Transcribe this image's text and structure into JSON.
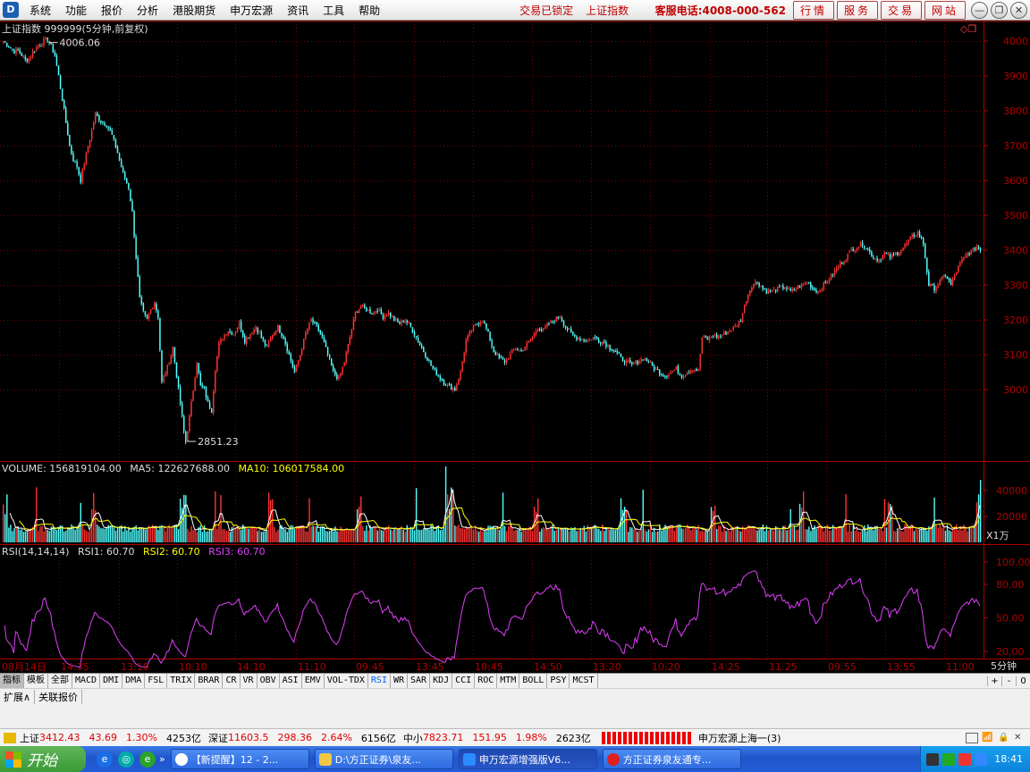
{
  "menubar": {
    "app_icon_text": "D",
    "items": [
      "系统",
      "功能",
      "报价",
      "分析",
      "港股期货",
      "申万宏源",
      "资讯",
      "工具",
      "帮助"
    ],
    "notices": [
      "交易已锁定",
      "上证指数"
    ],
    "hotline": "客服电话:4008-000-562",
    "service_buttons": [
      "行情",
      "服务",
      "交易",
      "网站"
    ]
  },
  "chart": {
    "title": "上证指数 999999(5分钟,前复权)",
    "price_ticks": [
      "4000",
      "3900",
      "3800",
      "3700",
      "3600",
      "3500",
      "3400",
      "3300",
      "3200",
      "3100",
      "3000"
    ],
    "high_label": "4006.06",
    "low_label": "2851.23",
    "volume": {
      "header": [
        "VOLUME: 156819104.00",
        "MA5: 122627688.00",
        "MA10: 106017584.00"
      ],
      "ticks": [
        "40000",
        "20000"
      ],
      "unit": "X1万"
    },
    "rsi": {
      "header": [
        "RSI(14,14,14)",
        "RSI1: 60.70",
        "RSI2: 60.70",
        "RSI3: 60.70"
      ],
      "ticks": [
        "100.00",
        "80.00",
        "50.00",
        "20.00"
      ]
    },
    "time_axis": [
      "08月14日",
      "14:35",
      "13:10",
      "10:10",
      "14:10",
      "11:10",
      "09:45",
      "13:45",
      "10:45",
      "14:50",
      "13:20",
      "10:20",
      "14:25",
      "11:25",
      "09:55",
      "13:55",
      "11:00"
    ],
    "period_label": "5分钟"
  },
  "chart_data": {
    "type": "candlestick",
    "price_ylim": [
      2800,
      4030
    ],
    "high": 4006.06,
    "low": 2851.23,
    "approx_path": [
      [
        0,
        4000
      ],
      [
        3,
        3985
      ],
      [
        6,
        3970
      ],
      [
        8,
        3975
      ],
      [
        10,
        3960
      ],
      [
        12,
        3945
      ],
      [
        14,
        3950
      ],
      [
        16,
        3970
      ],
      [
        18,
        3980
      ],
      [
        20,
        3990
      ],
      [
        22,
        4000
      ],
      [
        24,
        4006
      ],
      [
        26,
        3985
      ],
      [
        28,
        3960
      ],
      [
        30,
        3900
      ],
      [
        33,
        3800
      ],
      [
        36,
        3700
      ],
      [
        38,
        3660
      ],
      [
        40,
        3640
      ],
      [
        42,
        3600
      ],
      [
        44,
        3650
      ],
      [
        47,
        3720
      ],
      [
        50,
        3790
      ],
      [
        53,
        3770
      ],
      [
        56,
        3760
      ],
      [
        59,
        3730
      ],
      [
        62,
        3680
      ],
      [
        65,
        3620
      ],
      [
        68,
        3580
      ],
      [
        70,
        3510
      ],
      [
        72,
        3380
      ],
      [
        74,
        3260
      ],
      [
        76,
        3220
      ],
      [
        78,
        3200
      ],
      [
        80,
        3230
      ],
      [
        82,
        3250
      ],
      [
        84,
        3210
      ],
      [
        86,
        3020
      ],
      [
        88,
        3050
      ],
      [
        90,
        3080
      ],
      [
        92,
        3120
      ],
      [
        94,
        3040
      ],
      [
        96,
        2960
      ],
      [
        98,
        2880
      ],
      [
        99,
        2851
      ],
      [
        101,
        2920
      ],
      [
        103,
        3000
      ],
      [
        105,
        3080
      ],
      [
        107,
        3010
      ],
      [
        109,
        3000
      ],
      [
        111,
        2960
      ],
      [
        113,
        2940
      ],
      [
        115,
        3060
      ],
      [
        117,
        3130
      ],
      [
        119,
        3150
      ],
      [
        122,
        3170
      ],
      [
        125,
        3160
      ],
      [
        128,
        3190
      ],
      [
        131,
        3140
      ],
      [
        134,
        3160
      ],
      [
        137,
        3180
      ],
      [
        140,
        3150
      ],
      [
        143,
        3120
      ],
      [
        146,
        3160
      ],
      [
        149,
        3180
      ],
      [
        152,
        3150
      ],
      [
        155,
        3100
      ],
      [
        158,
        3050
      ],
      [
        161,
        3100
      ],
      [
        164,
        3160
      ],
      [
        167,
        3200
      ],
      [
        170,
        3180
      ],
      [
        173,
        3150
      ],
      [
        176,
        3100
      ],
      [
        179,
        3050
      ],
      [
        182,
        3030
      ],
      [
        185,
        3080
      ],
      [
        188,
        3150
      ],
      [
        191,
        3220
      ],
      [
        194,
        3240
      ],
      [
        197,
        3230
      ],
      [
        200,
        3220
      ],
      [
        203,
        3230
      ],
      [
        206,
        3210
      ],
      [
        209,
        3220
      ],
      [
        212,
        3200
      ],
      [
        215,
        3190
      ],
      [
        218,
        3200
      ],
      [
        221,
        3180
      ],
      [
        224,
        3150
      ],
      [
        227,
        3120
      ],
      [
        230,
        3090
      ],
      [
        233,
        3060
      ],
      [
        236,
        3040
      ],
      [
        239,
        3020
      ],
      [
        242,
        3010
      ],
      [
        245,
        3000
      ],
      [
        248,
        3050
      ],
      [
        251,
        3140
      ],
      [
        254,
        3170
      ],
      [
        257,
        3190
      ],
      [
        260,
        3200
      ],
      [
        263,
        3160
      ],
      [
        266,
        3110
      ],
      [
        269,
        3090
      ],
      [
        272,
        3080
      ],
      [
        275,
        3100
      ],
      [
        278,
        3120
      ],
      [
        281,
        3110
      ],
      [
        284,
        3130
      ],
      [
        287,
        3150
      ],
      [
        290,
        3180
      ],
      [
        293,
        3170
      ],
      [
        296,
        3190
      ],
      [
        299,
        3200
      ],
      [
        302,
        3210
      ],
      [
        305,
        3180
      ],
      [
        308,
        3160
      ],
      [
        311,
        3150
      ],
      [
        314,
        3145
      ],
      [
        317,
        3140
      ],
      [
        320,
        3150
      ],
      [
        323,
        3140
      ],
      [
        326,
        3135
      ],
      [
        329,
        3120
      ],
      [
        332,
        3110
      ],
      [
        335,
        3090
      ],
      [
        338,
        3080
      ],
      [
        341,
        3070
      ],
      [
        344,
        3080
      ],
      [
        347,
        3090
      ],
      [
        350,
        3080
      ],
      [
        353,
        3060
      ],
      [
        356,
        3050
      ],
      [
        359,
        3040
      ],
      [
        362,
        3050
      ],
      [
        365,
        3060
      ],
      [
        368,
        3040
      ],
      [
        371,
        3050
      ],
      [
        374,
        3060
      ],
      [
        377,
        3055
      ],
      [
        379,
        3150
      ],
      [
        382,
        3145
      ],
      [
        385,
        3155
      ],
      [
        388,
        3150
      ],
      [
        391,
        3160
      ],
      [
        394,
        3170
      ],
      [
        397,
        3180
      ],
      [
        400,
        3200
      ],
      [
        403,
        3260
      ],
      [
        406,
        3300
      ],
      [
        409,
        3310
      ],
      [
        412,
        3290
      ],
      [
        415,
        3280
      ],
      [
        418,
        3285
      ],
      [
        421,
        3290
      ],
      [
        424,
        3295
      ],
      [
        427,
        3280
      ],
      [
        430,
        3290
      ],
      [
        433,
        3300
      ],
      [
        436,
        3310
      ],
      [
        439,
        3290
      ],
      [
        442,
        3280
      ],
      [
        445,
        3300
      ],
      [
        448,
        3320
      ],
      [
        451,
        3340
      ],
      [
        454,
        3360
      ],
      [
        457,
        3380
      ],
      [
        460,
        3400
      ],
      [
        463,
        3410
      ],
      [
        466,
        3420
      ],
      [
        469,
        3400
      ],
      [
        472,
        3380
      ],
      [
        475,
        3370
      ],
      [
        478,
        3390
      ],
      [
        481,
        3380
      ],
      [
        484,
        3390
      ],
      [
        487,
        3400
      ],
      [
        490,
        3420
      ],
      [
        493,
        3440
      ],
      [
        496,
        3450
      ],
      [
        499,
        3420
      ],
      [
        502,
        3300
      ],
      [
        505,
        3290
      ],
      [
        508,
        3310
      ],
      [
        511,
        3330
      ],
      [
        514,
        3300
      ],
      [
        517,
        3340
      ],
      [
        520,
        3370
      ],
      [
        523,
        3390
      ],
      [
        526,
        3400
      ],
      [
        528,
        3410
      ],
      [
        530,
        3400
      ]
    ],
    "volume_ylim": [
      0,
      50000
    ],
    "volume_unit": "X1万",
    "volume_ma": {
      "VOLUME": 156819104.0,
      "MA5": 122627688.0,
      "MA10": 106017584.0
    },
    "rsi_ylim": [
      10,
      105
    ],
    "rsi_latest": {
      "RSI1": 60.7,
      "RSI2": 60.7,
      "RSI3": 60.7
    },
    "colors": {
      "up": "#ff3333",
      "down": "#54ffff",
      "axis": "#b00000",
      "grid": "#7a0000",
      "rsi": "#e040fb",
      "ma10": "#ffff00",
      "ma5": "#ffffff"
    }
  },
  "toolbar": {
    "tools": [
      "指标",
      "模板",
      "全部",
      "MACD",
      "DMI",
      "DMA",
      "FSL",
      "TRIX",
      "BRAR",
      "CR",
      "VR",
      "OBV",
      "ASI",
      "EMV",
      "VOL-TDX",
      "RSI",
      "WR",
      "SAR",
      "KDJ",
      "CCI",
      "ROC",
      "MTM",
      "BOLL",
      "PSY",
      "MCST"
    ],
    "active": "RSI",
    "right": [
      "+",
      "-",
      "0"
    ]
  },
  "subtabs": [
    "扩展∧",
    "关联报价"
  ],
  "statusbar": {
    "indices": [
      {
        "name": "上证",
        "value": "3412.43",
        "change": "43.69",
        "pct": "1.30%",
        "amount": "4253亿"
      },
      {
        "name": "深证",
        "value": "11603.5",
        "change": "298.36",
        "pct": "2.64%",
        "amount": "6156亿"
      },
      {
        "name": "中小",
        "value": "7823.71",
        "change": "151.95",
        "pct": "1.98%",
        "amount": "2623亿"
      }
    ],
    "server": "申万宏源上海一(3)"
  },
  "taskbar": {
    "start": "开始",
    "tasks": [
      "【新提醒】12 - 2...",
      "D:\\方正证券\\泉友...",
      "申万宏源增强版V6...",
      "方正证券泉友通专..."
    ],
    "time": "18:41"
  }
}
